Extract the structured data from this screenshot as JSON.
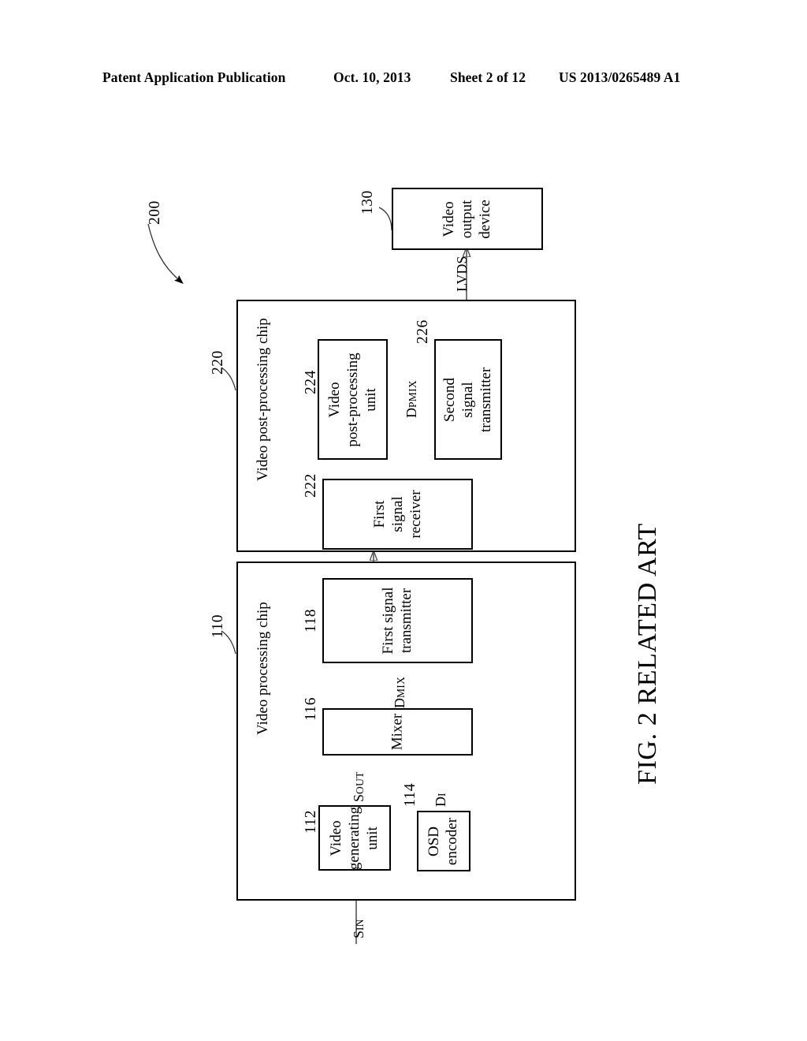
{
  "header": {
    "publication": "Patent Application Publication",
    "date": "Oct. 10, 2013",
    "sheet": "Sheet 2 of 12",
    "patent_number": "US 2013/0265489 A1"
  },
  "figure": {
    "caption": "FIG. 2 RELATED ART",
    "system_ref": "200",
    "blocks": [
      {
        "id": "video-output-device",
        "label": "Video\noutput\ndevice",
        "ref": "130"
      },
      {
        "id": "video-post-processing-chip",
        "label": "Video post-processing chip",
        "ref": "220"
      },
      {
        "id": "video-post-processing-unit",
        "label": "Video\npost-processing\nunit",
        "ref": "224"
      },
      {
        "id": "second-signal-transmitter",
        "label": "Second\nsignal\ntransmitter",
        "ref": "226"
      },
      {
        "id": "first-signal-receiver",
        "label": "First\nsignal\nreceiver",
        "ref": "222"
      },
      {
        "id": "video-processing-chip",
        "label": "Video processing chip",
        "ref": "110"
      },
      {
        "id": "first-signal-transmitter",
        "label": "First signal\ntransmitter",
        "ref": "118"
      },
      {
        "id": "mixer",
        "label": "Mixer",
        "ref": "116"
      },
      {
        "id": "video-generating-unit",
        "label": "Video\ngenerating\nunit",
        "ref": "112"
      },
      {
        "id": "osd-encoder",
        "label": "OSD\nencoder",
        "ref": "114"
      }
    ],
    "signals": [
      {
        "id": "lvds",
        "base": "LVDS",
        "sub": ""
      },
      {
        "id": "d-pmix",
        "base": "D",
        "sub": "PMIX"
      },
      {
        "id": "d-mix",
        "base": "D",
        "sub": "MIX"
      },
      {
        "id": "s-out",
        "base": "S",
        "sub": "OUT"
      },
      {
        "id": "d-i",
        "base": "D",
        "sub": "I"
      },
      {
        "id": "s-in",
        "base": "S",
        "sub": "IN"
      }
    ],
    "refs": {
      "r130": "130",
      "r220": "220",
      "r224": "224",
      "r226": "226",
      "r222": "222",
      "r110": "110",
      "r118": "118",
      "r116": "116",
      "r112": "112",
      "r114": "114",
      "r200": "200"
    },
    "block_labels": {
      "video_output_device_l1": "Video",
      "video_output_device_l2": "output",
      "video_output_device_l3": "device",
      "post_chip": "Video post-processing chip",
      "vpu_l1": "Video",
      "vpu_l2": "post-processing",
      "vpu_l3": "unit",
      "sst_l1": "Second",
      "sst_l2": "signal",
      "sst_l3": "transmitter",
      "fsr_l1": "First",
      "fsr_l2": "signal",
      "fsr_l3": "receiver",
      "proc_chip": "Video processing chip",
      "fst_l1": "First signal",
      "fst_l2": "transmitter",
      "mixer": "Mixer",
      "vgu_l1": "Video",
      "vgu_l2": "generating",
      "vgu_l3": "unit",
      "osd_l1": "OSD",
      "osd_l2": "encoder"
    },
    "signal_text": {
      "lvds": "LVDS",
      "d_base": "D",
      "s_base": "S",
      "pmix_sub": "PMIX",
      "mix_sub": "MIX",
      "out_sub": "OUT",
      "i_sub": "I",
      "in_sub": "IN"
    }
  },
  "colors": {
    "ink": "#000000",
    "line": "#555555",
    "background": "#ffffff"
  }
}
